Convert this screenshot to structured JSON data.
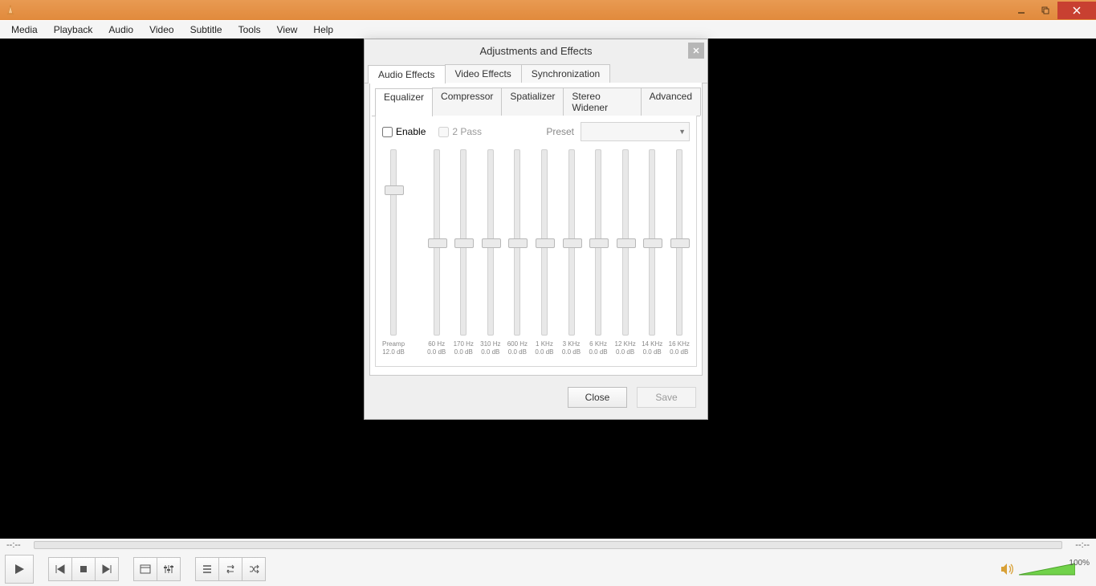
{
  "window": {
    "minimize_tip": "Minimize",
    "maximize_tip": "Restore",
    "close_tip": "Close"
  },
  "menubar": [
    "Media",
    "Playback",
    "Audio",
    "Video",
    "Subtitle",
    "Tools",
    "View",
    "Help"
  ],
  "status": {
    "time_left": "--:--",
    "time_right": "--:--"
  },
  "controls": {
    "volume_pct": "100%",
    "play_tip": "Play",
    "prev_tip": "Previous",
    "stop_tip": "Stop",
    "next_tip": "Next",
    "fullscreen_tip": "Fullscreen",
    "exteq_tip": "Extended settings",
    "playlist_tip": "Playlist",
    "loop_tip": "Loop",
    "shuffle_tip": "Random"
  },
  "dialog": {
    "title": "Adjustments and Effects",
    "tabs": [
      "Audio Effects",
      "Video Effects",
      "Synchronization"
    ],
    "subtabs": [
      "Equalizer",
      "Compressor",
      "Spatializer",
      "Stereo Widener",
      "Advanced"
    ],
    "enable_label": "Enable",
    "two_pass_label": "2 Pass",
    "preset_label": "Preset",
    "close_btn": "Close",
    "save_btn": "Save",
    "preamp": {
      "label": "Preamp",
      "value": "12.0 dB",
      "thumb_pct": 20
    },
    "bands": [
      {
        "freq": "60 Hz",
        "db": "0.0 dB",
        "thumb_pct": 50
      },
      {
        "freq": "170 Hz",
        "db": "0.0 dB",
        "thumb_pct": 50
      },
      {
        "freq": "310 Hz",
        "db": "0.0 dB",
        "thumb_pct": 50
      },
      {
        "freq": "600 Hz",
        "db": "0.0 dB",
        "thumb_pct": 50
      },
      {
        "freq": "1 KHz",
        "db": "0.0 dB",
        "thumb_pct": 50
      },
      {
        "freq": "3 KHz",
        "db": "0.0 dB",
        "thumb_pct": 50
      },
      {
        "freq": "6 KHz",
        "db": "0.0 dB",
        "thumb_pct": 50
      },
      {
        "freq": "12 KHz",
        "db": "0.0 dB",
        "thumb_pct": 50
      },
      {
        "freq": "14 KHz",
        "db": "0.0 dB",
        "thumb_pct": 50
      },
      {
        "freq": "16 KHz",
        "db": "0.0 dB",
        "thumb_pct": 50
      }
    ]
  }
}
